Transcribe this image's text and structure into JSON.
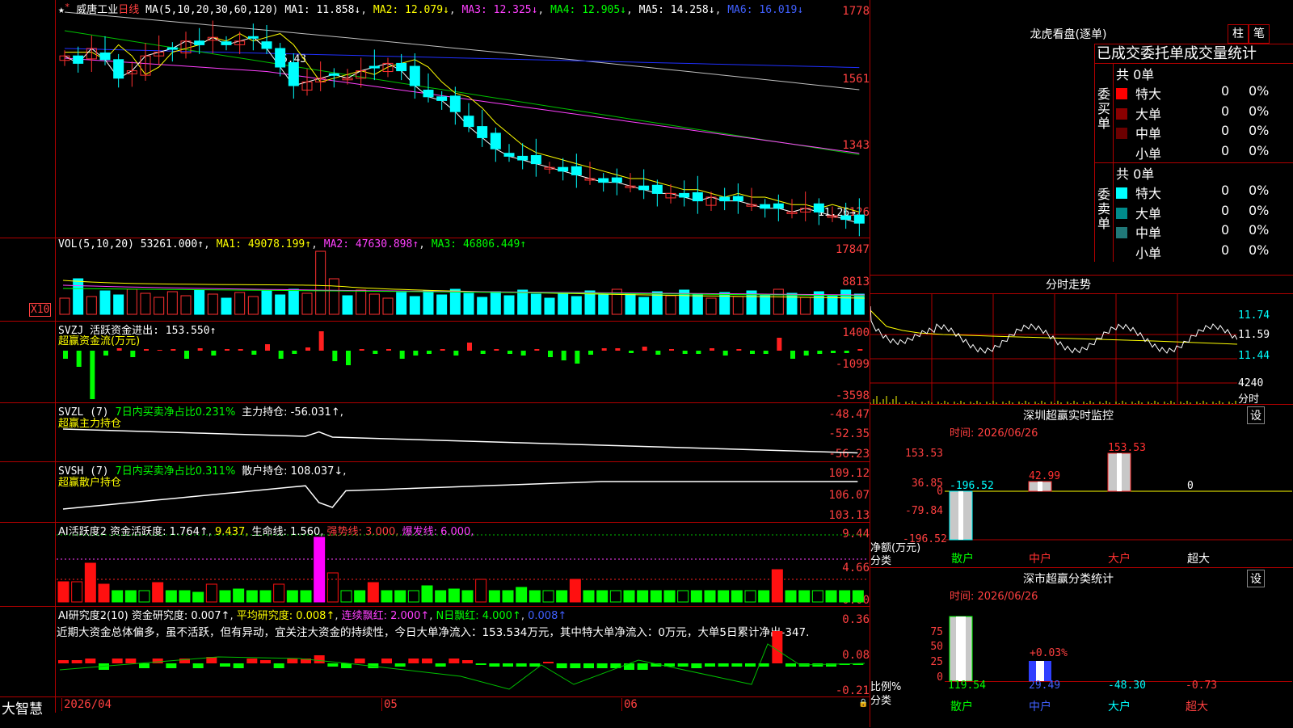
{
  "stock": {
    "name": "威唐工业",
    "period": "日线"
  },
  "main": {
    "ma_header": "MA(5,10,20,30,60,120)",
    "ma1": "MA1: 11.858↓",
    "ma2": "MA2: 12.079↓",
    "ma3": "MA3: 12.325↓",
    "ma4": "MA4: 12.905↓",
    "ma5": "MA5: 14.258↓",
    "ma6": "MA6: 16.019↓",
    "y_labels": [
      "1778",
      "1561",
      "1343",
      "1126"
    ],
    "high_mark": "16.43",
    "low_mark": "11.26→"
  },
  "vol": {
    "header": "VOL(5,10,20)",
    "value": "53261.000↑",
    "ma1": "MA1: 49078.199↑",
    "ma2": "MA2: 47630.898↑",
    "ma3": "MA3: 46806.449↑",
    "y_labels": [
      "17847",
      "8813"
    ],
    "unit": "X10"
  },
  "svzj": {
    "header": "SVZJ  活跃资金进出: 153.550↑",
    "sub": "超赢资金流(万元)",
    "y_labels": [
      "1400",
      "-1099",
      "-3598"
    ]
  },
  "svzl": {
    "header": "SVZL (7)",
    "p1": "7日内买卖净占比0.231%",
    "p2": "主力持仓: -56.031↑,",
    "sub": "超赢主力持仓",
    "y_labels": [
      "-48.47",
      "-52.35",
      "-56.23"
    ]
  },
  "svsh": {
    "header": "SVSH (7)",
    "p1": "7日内买卖净占比0.311%",
    "p2": "散户持仓: 108.037↓,",
    "sub": "超赢散户持仓",
    "y_labels": [
      "109.12",
      "106.07",
      "103.13"
    ]
  },
  "ai1": {
    "header": "AI活跃度2",
    "p1": "资金活跃度: 1.764↑",
    "p2": "9.437,",
    "p3": "生命线: 1.560,",
    "p4": "强势线: 3.000,",
    "p5": "爆发线: 6.000,",
    "y_labels": [
      "9.44",
      "4.66",
      "0.00"
    ]
  },
  "ai2": {
    "header": "AI研究度2(10)",
    "p1": "资金研究度: 0.007↑",
    "p2": "平均研究度: 0.008↑",
    "p3": "连续飘红: 2.000↑",
    "p4": "N日飘红: 4.000↑",
    "p5": "0.008↑",
    "commentary": "近期大资金总体偏多，虽不活跃，但有异动，宜关注大资金的持续性，今日大单净流入：153.534万元，其中特大单净流入：0万元，大单5日累计净出-347.",
    "y_labels": [
      "0.36",
      "0.08",
      "-0.21"
    ]
  },
  "bottom": {
    "brand": "大智慧",
    "date": "2026/04",
    "months": [
      "05",
      "06"
    ]
  },
  "dragon": {
    "title": "龙虎看盘(逐单)",
    "tab1": "柱",
    "tab2": "笔",
    "heading": "已成交委托单成交量统计",
    "buy": {
      "label": "委买单",
      "total": "共 0单",
      "rows": [
        {
          "name": "特大",
          "v": "0",
          "p": "0%"
        },
        {
          "name": "大单",
          "v": "0",
          "p": "0%"
        },
        {
          "name": "中单",
          "v": "0",
          "p": "0%"
        },
        {
          "name": "小单",
          "v": "0",
          "p": "0%"
        }
      ]
    },
    "sell": {
      "label": "委卖单",
      "total": "共 0单",
      "rows": [
        {
          "name": "特大",
          "v": "0",
          "p": "0%"
        },
        {
          "name": "大单",
          "v": "0",
          "p": "0%"
        },
        {
          "name": "中单",
          "v": "0",
          "p": "0%"
        },
        {
          "name": "小单",
          "v": "0",
          "p": "0%"
        }
      ]
    }
  },
  "intraday": {
    "title": "分时走势",
    "y_labels": [
      "11.74",
      "11.59",
      "11.44"
    ],
    "vol_label": "4240",
    "unit": "分时"
  },
  "monitor": {
    "title": "深圳超赢实时监控",
    "btn": "设",
    "date": "时间: 2026/06/26",
    "y_labels": [
      "153.53",
      "36.85",
      "0",
      "-79.84",
      "-196.52"
    ],
    "bar_values": [
      "-196.52",
      "42.99",
      "153.53",
      "0"
    ],
    "y_title": "净额(万元)",
    "x_title": "分类",
    "cats": [
      "散户",
      "中户",
      "大户",
      "超大"
    ]
  },
  "stats": {
    "title": "深市超赢分类统计",
    "btn": "设",
    "date": "时间: 2026/06/26",
    "y_labels": [
      "75",
      "50",
      "25",
      "0"
    ],
    "annot": "+0.03%",
    "y_title": "比例%",
    "x_title": "分类",
    "values": [
      "119.54",
      "29.49",
      "-48.30",
      "-0.73"
    ],
    "cats": [
      "散户",
      "中户",
      "大户",
      "超大"
    ]
  }
}
